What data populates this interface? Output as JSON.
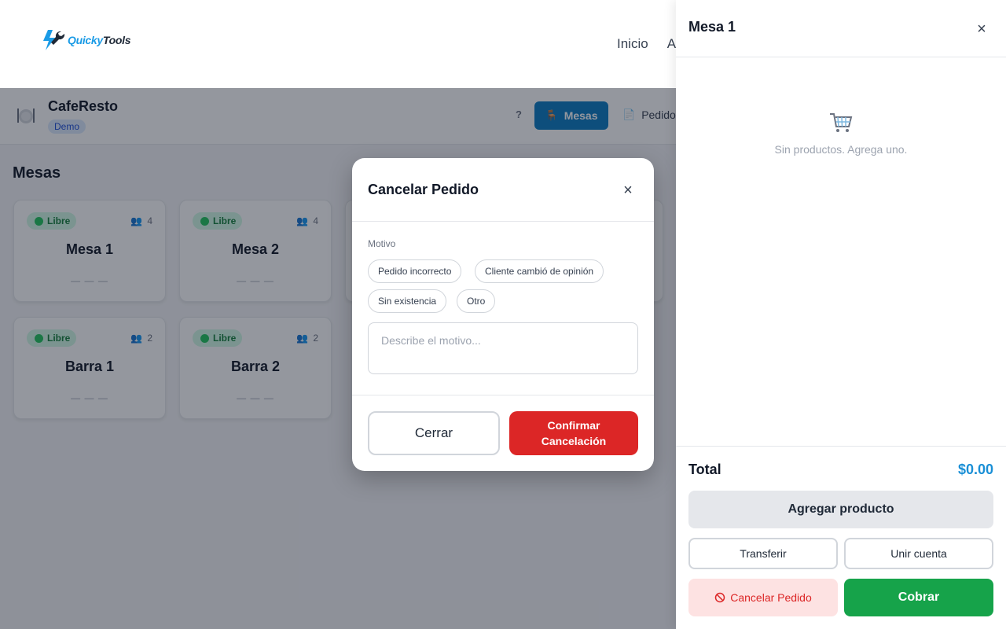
{
  "topnav": {
    "logo_part1": "Quicky",
    "logo_part2": "Tools",
    "links": [
      "Inicio",
      "A"
    ]
  },
  "app": {
    "name": "CafeResto",
    "badge": "Demo",
    "help": "?",
    "tabs": [
      {
        "label": "Mesas",
        "icon": "chair-icon",
        "active": true
      },
      {
        "label": "Pedido",
        "icon": "document-icon",
        "active": false
      }
    ]
  },
  "main": {
    "section_title": "Mesas",
    "tables": [
      {
        "name": "Mesa 1",
        "status": "Libre",
        "seats": "4",
        "amount": "— — —"
      },
      {
        "name": "Mesa 2",
        "status": "Libre",
        "seats": "4",
        "amount": "— — —"
      },
      {
        "name": "Barra 1",
        "status": "Libre",
        "seats": "2",
        "amount": "— — —"
      },
      {
        "name": "Barra 2",
        "status": "Libre",
        "seats": "2",
        "amount": "— — —"
      }
    ]
  },
  "modal": {
    "title": "Cancelar Pedido",
    "close": "×",
    "motivo_label": "Motivo",
    "reasons": [
      "Pedido incorrecto",
      "Cliente cambió de opinión",
      "Sin existencia",
      "Otro"
    ],
    "placeholder": "Describe el motivo...",
    "cerrar_label": "Cerrar",
    "confirm_label": "Confirmar Cancelación"
  },
  "panel": {
    "title": "Mesa 1",
    "close": "×",
    "empty_message": "Sin productos. Agrega uno.",
    "total_label": "Total",
    "total_value": "$0.00",
    "add_label": "Agregar producto",
    "transfer_label": "Transferir",
    "merge_label": "Unir cuenta",
    "cancel_label": "Cancelar Pedido",
    "charge_label": "Cobrar"
  },
  "colors": {
    "primary": "#0a7bc2",
    "danger": "#dc2626",
    "success": "#16a34a",
    "total": "#1a8fd6"
  }
}
